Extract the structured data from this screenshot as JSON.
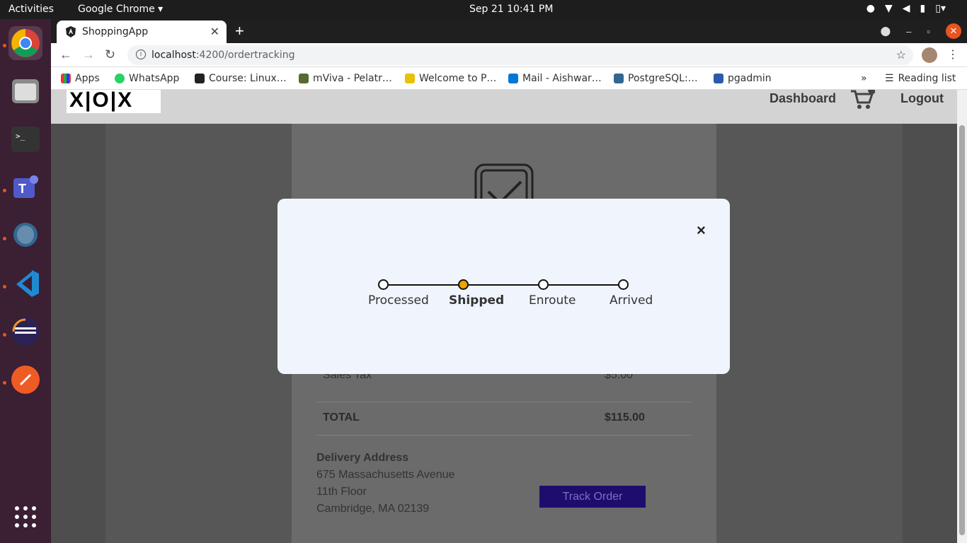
{
  "system": {
    "activities": "Activities",
    "app_name": "Google Chrome",
    "clock": "Sep 21  10:41 PM"
  },
  "browser": {
    "tab_title": "ShoppingApp",
    "url_host": "localhost",
    "url_path": ":4200/ordertracking",
    "bookmarks": [
      {
        "label": "Apps",
        "icon": "apps-grid-icon"
      },
      {
        "label": "WhatsApp",
        "icon": "whatsapp-icon"
      },
      {
        "label": "Course: Linux…",
        "icon": "course-icon"
      },
      {
        "label": "mViva - Pelatr…",
        "icon": "mviva-icon"
      },
      {
        "label": "Welcome to P…",
        "icon": "pin-icon"
      },
      {
        "label": "Mail - Aishwar…",
        "icon": "outlook-icon"
      },
      {
        "label": "PostgreSQL:…",
        "icon": "postgres-icon"
      },
      {
        "label": "pgadmin",
        "icon": "pgadmin-icon"
      }
    ],
    "reading_list": "Reading list"
  },
  "app": {
    "logo_text": "X|O|X",
    "nav": {
      "dashboard": "Dashboard",
      "logout": "Logout"
    },
    "order": {
      "sales_tax_label": "Sales Tax",
      "sales_tax_value": "$5.00",
      "total_label": "TOTAL",
      "total_value": "$115.00",
      "delivery_heading": "Delivery Address",
      "address": [
        "675 Massachusetts Avenue",
        "11th Floor",
        "Cambridge, MA 02139"
      ],
      "track_button": "Track Order"
    }
  },
  "modal": {
    "close_symbol": "×",
    "steps": [
      {
        "label": "Processed",
        "active": false
      },
      {
        "label": "Shipped",
        "active": true
      },
      {
        "label": "Enroute",
        "active": false
      },
      {
        "label": "Arrived",
        "active": false
      }
    ],
    "active_color": "#f0a300"
  }
}
